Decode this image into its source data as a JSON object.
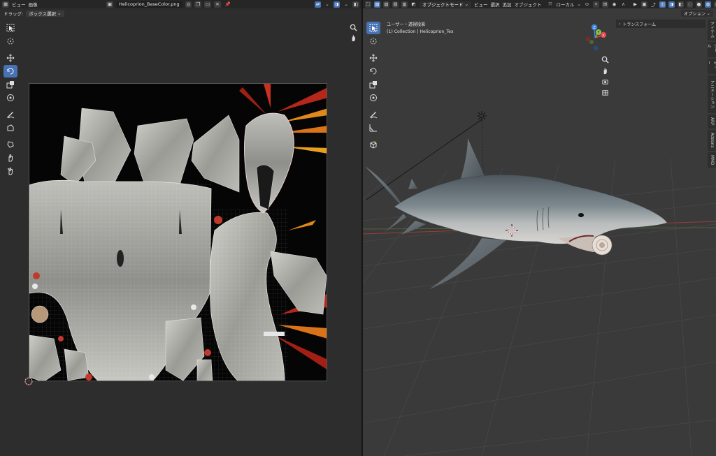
{
  "uv_editor": {
    "header": {
      "menus": [
        "ビュー",
        "画像"
      ],
      "image_name": "Helicoprion_BaseColor.png"
    },
    "subheader": {
      "drag_label": "ドラッグ:",
      "drag_mode": "ボックス選択"
    },
    "tools": [
      "select-box",
      "cursor",
      "move",
      "rotate",
      "scale",
      "transform",
      "annotate",
      "rip",
      "grab",
      "relax",
      "pinch"
    ]
  },
  "viewport": {
    "header": {
      "mode": "オブジェクトモード",
      "menus": [
        "ビュー",
        "選択",
        "追加",
        "オブジェクト"
      ],
      "orientation": "ローカル"
    },
    "options_label": "オプション",
    "overlay": {
      "view_name": "ユーザー・透視投影",
      "collection": "(1) Collection | Helicoprion_Tex"
    },
    "gizmo": {
      "x": "X",
      "y": "Y",
      "z": "Z"
    },
    "transform_panel": "トランスフォーム",
    "sidebar_tabs": [
      "アイテム",
      "ツール",
      "ビュー",
      "アニメーション",
      "ARP",
      "Addons",
      "MMD"
    ],
    "tools": [
      "select-box",
      "cursor",
      "move",
      "rotate",
      "scale",
      "transform",
      "annotate",
      "measure",
      "add-cube"
    ]
  },
  "colors": {
    "accent": "#4772b3",
    "header": "#262626",
    "uv_bg": "#2d2d2d",
    "viewport_bg": "#3a3a3a",
    "axis_x": "#e0444f",
    "axis_y": "#8bc34a",
    "axis_z": "#3d86e0"
  }
}
